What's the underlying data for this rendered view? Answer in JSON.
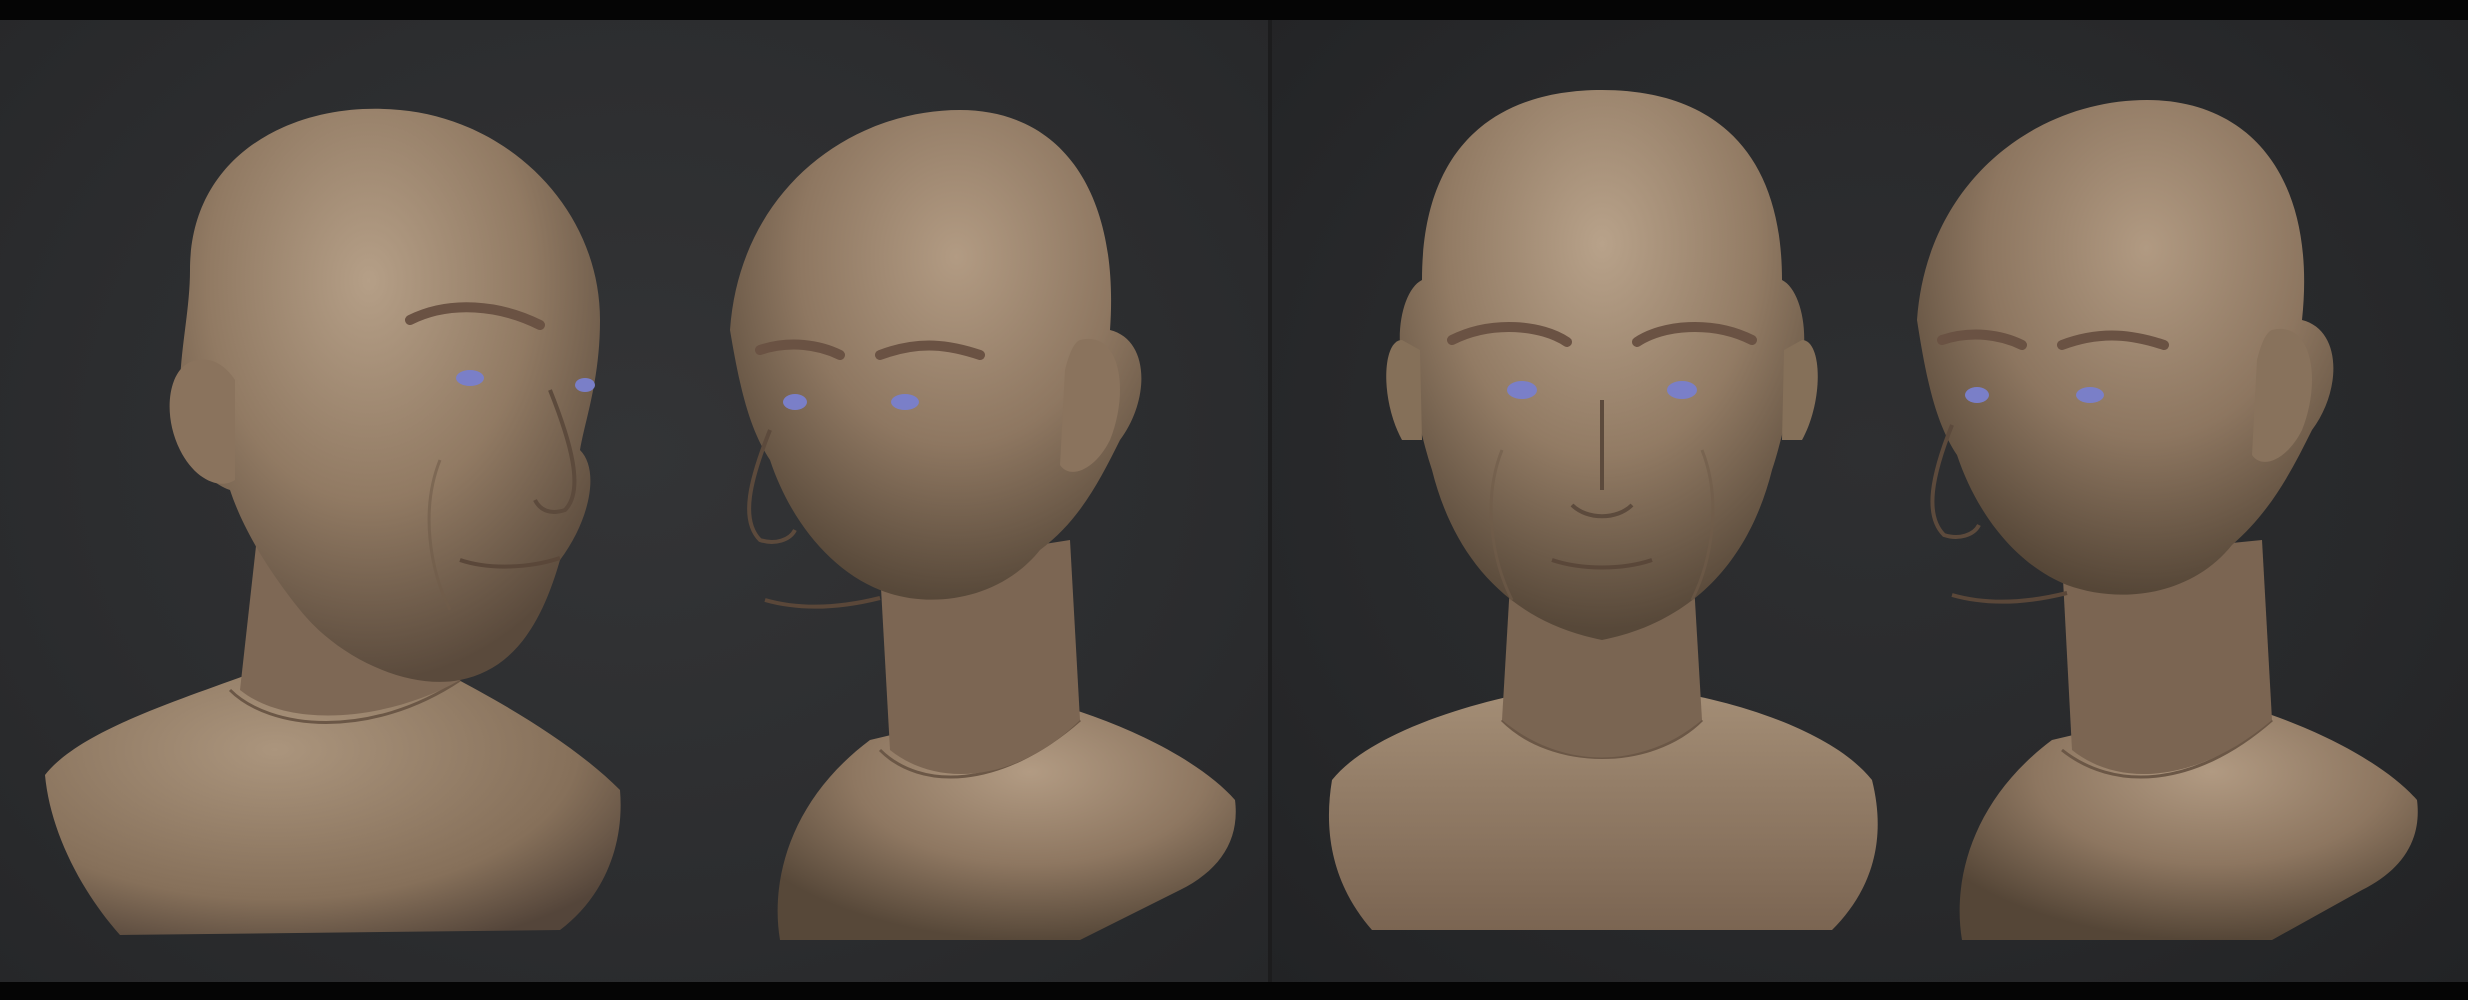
{
  "viewer": {
    "panels": [
      {
        "name": "left-panel",
        "busts": [
          "three-quarter-right",
          "three-quarter-left"
        ]
      },
      {
        "name": "right-panel",
        "busts": [
          "front",
          "three-quarter-left"
        ]
      }
    ],
    "colors": {
      "background_left": "#2d2e30",
      "background_right": "#27282a",
      "frame": "#050505",
      "skin": "#9c8670",
      "skin_shadow": "#5e4d3e",
      "iris": "#7a7fc8"
    }
  }
}
